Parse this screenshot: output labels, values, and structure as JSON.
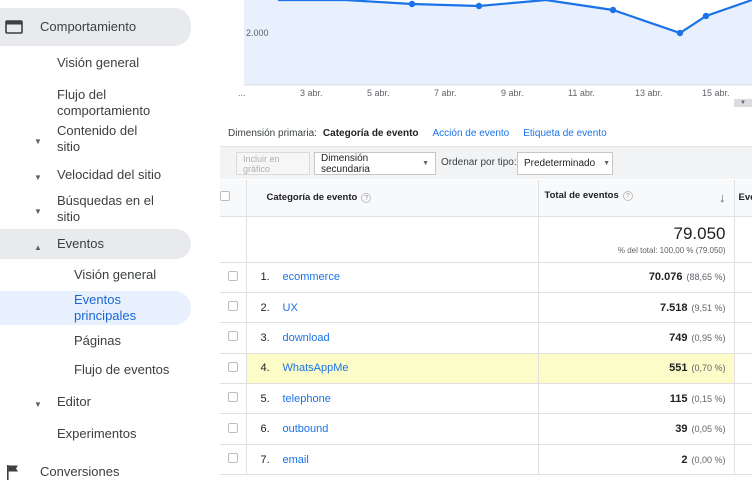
{
  "sidebar": {
    "behavior": "Comportamiento",
    "overview": "Visión general",
    "flow": "Flujo del comportamiento",
    "site_content": "Contenido del sitio",
    "site_speed": "Velocidad del sitio",
    "site_search": "Búsquedas en el sitio",
    "events": "Eventos",
    "events_overview": "Visión general",
    "top_events": "Eventos principales",
    "pages": "Páginas",
    "events_flow": "Flujo de eventos",
    "publisher": "Editor",
    "experiments": "Experimentos",
    "conversions": "Conversiones"
  },
  "chart": {
    "y_label": "2.000",
    "x_ticks": [
      "3 abr.",
      "5 abr.",
      "7 abr.",
      "9 abr.",
      "11 abr.",
      "13 abr.",
      "15 abr."
    ],
    "color": "#1a73e8",
    "fill": "#e8f0fe"
  },
  "dimensions": {
    "label": "Dimensión primaria:",
    "current": "Categoría de evento",
    "alt1": "Acción de evento",
    "alt2": "Etiqueta de evento"
  },
  "toolbar": {
    "plot_rows": "Incluir en gráfico",
    "secondary": "Dimensión secundaria",
    "sort_label": "Ordenar por tipo:",
    "sort_value": "Predeterminado"
  },
  "table": {
    "col_category": "Categoría de evento",
    "col_total": "Total de eventos",
    "col_next": "Even",
    "sort_arrow": "↓",
    "total_value": "79.050",
    "total_sub": "% del total: 100,00 % (79.050)",
    "rows": [
      {
        "idx": "1.",
        "cat": "ecommerce",
        "val": "70.076",
        "pct": "(88,65 %)"
      },
      {
        "idx": "2.",
        "cat": "UX",
        "val": "7.518",
        "pct": "(9,51 %)"
      },
      {
        "idx": "3.",
        "cat": "download",
        "val": "749",
        "pct": "(0,95 %)"
      },
      {
        "idx": "4.",
        "cat": "WhatsAppMe",
        "val": "551",
        "pct": "(0,70 %)"
      },
      {
        "idx": "5.",
        "cat": "telephone",
        "val": "115",
        "pct": "(0,15 %)"
      },
      {
        "idx": "6.",
        "cat": "outbound",
        "val": "39",
        "pct": "(0,05 %)"
      },
      {
        "idx": "7.",
        "cat": "email",
        "val": "2",
        "pct": "(0,00 %)"
      }
    ]
  }
}
